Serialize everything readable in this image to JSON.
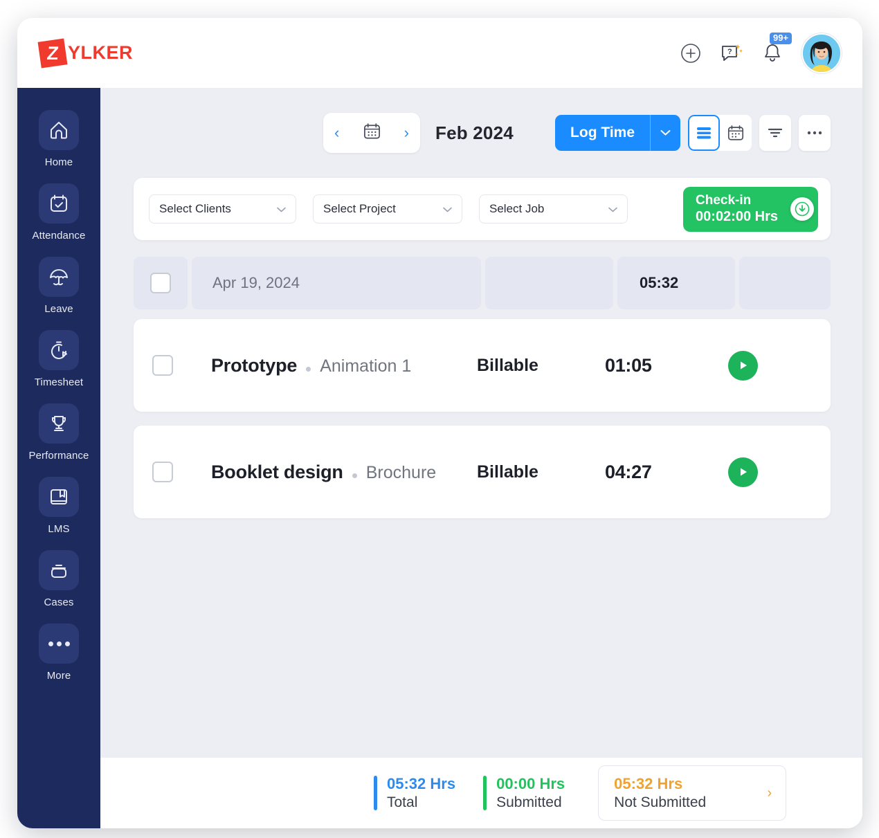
{
  "app": {
    "logo_mark_letter": "Z",
    "logo_text": "YLKER",
    "brand_color": "#f03a2e"
  },
  "header": {
    "icons": [
      {
        "name": "add-circle-icon",
        "label": "Add"
      },
      {
        "name": "help-chat-icon",
        "label": "Help"
      },
      {
        "name": "notifications-bell-icon",
        "label": "Notifications"
      }
    ],
    "notification_badge": "99+",
    "avatar_alt": "User profile"
  },
  "sidebar": {
    "items": [
      {
        "label": "Home",
        "icon": "home-icon"
      },
      {
        "label": "Attendance",
        "icon": "calendar-check-icon"
      },
      {
        "label": "Leave",
        "icon": "beach-umbrella-icon"
      },
      {
        "label": "Timesheet",
        "icon": "stopwatch-play-icon"
      },
      {
        "label": "Performance",
        "icon": "trophy-icon"
      },
      {
        "label": "LMS",
        "icon": "book-icon"
      },
      {
        "label": "Cases",
        "icon": "briefcase-icon"
      },
      {
        "label": "More",
        "icon": "ellipsis-icon"
      }
    ]
  },
  "toolbar": {
    "prev_label": "‹",
    "next_label": "›",
    "calendar_icon": "calendar-icon",
    "month_label": "Feb 2024",
    "log_time_label": "Log Time",
    "log_time_caret": "⌄",
    "view_list_icon": "list-view-icon",
    "view_calendar_icon": "calendar-view-icon",
    "filter_icon": "filter-icon",
    "more_icon": "more-options-icon"
  },
  "filters": {
    "clients": {
      "value": "Select Clients",
      "caret": "⌄"
    },
    "project": {
      "value": "Select Project",
      "caret": "⌄"
    },
    "job": {
      "value": "Select Job",
      "caret": "⌄"
    },
    "checkin": {
      "title": "Check-in",
      "timer": "00:02:00 Hrs",
      "knob_icon": "checkin-arrow-icon",
      "color": "#23c263"
    }
  },
  "timesheet": {
    "date_group": {
      "date": "Apr 19, 2024",
      "total": "05:32"
    },
    "entries": [
      {
        "job": "Prototype",
        "separator": "•",
        "project": "Animation 1",
        "billable": "Billable",
        "duration": "01:05",
        "play_icon": "play-timer-icon"
      },
      {
        "job": "Booklet design",
        "separator": "•",
        "project": "Brochure",
        "billable": "Billable",
        "duration": "04:27",
        "play_icon": "play-timer-icon"
      }
    ]
  },
  "footer": {
    "total": {
      "value": "05:32 Hrs",
      "label": "Total",
      "color": "#2d8bf0"
    },
    "submitted": {
      "value": "00:00 Hrs",
      "label": "Submitted",
      "color": "#21c35c"
    },
    "not_submitted": {
      "value": "05:32 Hrs",
      "label": "Not Submitted",
      "color": "#f0a22e",
      "chevron": "›"
    }
  }
}
